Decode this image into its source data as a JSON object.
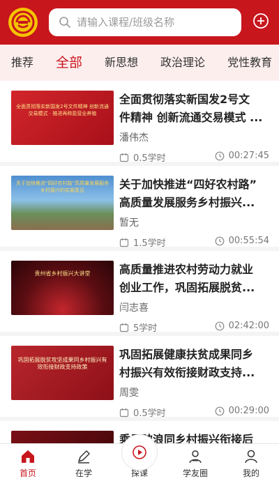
{
  "search": {
    "placeholder": "请输入课程/班级名称"
  },
  "tabs": [
    {
      "label": "推荐"
    },
    {
      "label": "全部"
    },
    {
      "label": "新思想"
    },
    {
      "label": "政治理论"
    },
    {
      "label": "党性教育"
    }
  ],
  "active_tab": "全部",
  "courses": [
    {
      "title_line1": "全面贯彻落实新国发2号文",
      "title_line2": "件精神 创新流通交易模式 ...",
      "author": "潘伟杰",
      "hours": "0.5学时",
      "duration": "00:27:45",
      "thumb_text": "全面贯彻落实新国发2号文件精神 创新流通交易模式 · 推进再称盈营业养殖"
    },
    {
      "title_line1": "关于加快推进“四好农村路”",
      "title_line2": "高质量发展服务乡村振兴...",
      "author": "暂无",
      "hours": "1.5学时",
      "duration": "00:55:54",
      "thumb_text": "关于加快推进“四好农村路”高质量发展服务乡村振兴的实施意见"
    },
    {
      "title_line1": "高质量推进农村劳动力就业",
      "title_line2": "创业工作，巩固拓展脱贫...",
      "author": "闫志喜",
      "hours": "5学时",
      "duration": "02:42:00",
      "thumb_text": "贵州省乡村振兴大讲堂"
    },
    {
      "title_line1": "巩固拓展健康扶贫成果同乡",
      "title_line2": "村振兴有效衔接财政支持...",
      "author": "周雯",
      "hours": "0.5学时",
      "duration": "00:29:00",
      "thumb_text": "巩固拓展脱贫攻坚成果同乡村振兴有效衔接财政支持政策"
    },
    {
      "title_line1": "乘风破浪同乡村振兴衔接后",
      "title_line2": "",
      "author": "",
      "hours": "",
      "duration": "",
      "thumb_text": ""
    }
  ],
  "bottom_nav": [
    {
      "label": "首页"
    },
    {
      "label": "在学"
    },
    {
      "label": "探课"
    },
    {
      "label": "学友圈"
    },
    {
      "label": "我的"
    }
  ],
  "colors": {
    "brand_red": "#c8161d",
    "logo_yellow": "#f5c400",
    "tab_bg": "#fdeeee"
  }
}
